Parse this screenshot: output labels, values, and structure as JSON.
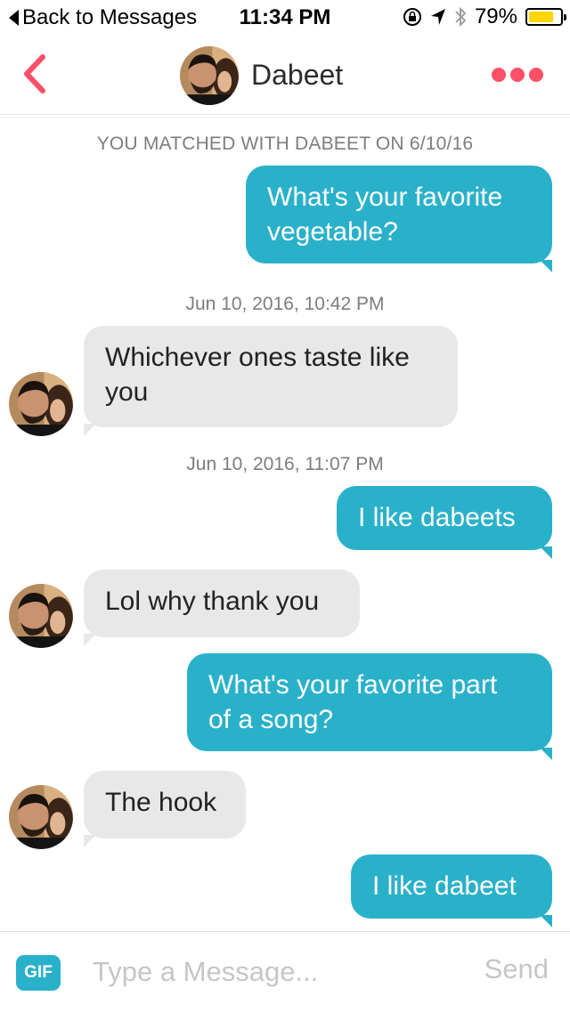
{
  "status_bar": {
    "back_label": "Back to Messages",
    "time": "11:34 PM",
    "battery_percent_label": "79%",
    "battery_level": 0.79,
    "icons": [
      "orientation-lock-icon",
      "location-arrow-icon",
      "bluetooth-icon",
      "battery-icon"
    ]
  },
  "header": {
    "name": "Dabeet",
    "accent_color": "#fd5068",
    "icons": [
      "back-chevron-icon",
      "more-dots-icon"
    ]
  },
  "conversation": {
    "match_banner": "YOU MATCHED WITH DABEET ON 6/10/16",
    "messages": [
      {
        "direction": "out",
        "lines": [
          "What's your favorite",
          "vegetable?"
        ]
      },
      {
        "type": "timestamp",
        "text": "Jun 10, 2016, 10:42 PM"
      },
      {
        "direction": "in",
        "lines": [
          "Whichever ones taste like",
          "you"
        ]
      },
      {
        "type": "timestamp",
        "text": "Jun 10, 2016, 11:07 PM"
      },
      {
        "direction": "out",
        "lines": [
          "I like dabeets"
        ]
      },
      {
        "direction": "in",
        "lines": [
          "Lol why thank you"
        ]
      },
      {
        "direction": "out",
        "lines": [
          "What's your favorite part",
          "of a song?"
        ]
      },
      {
        "direction": "in",
        "lines": [
          "The hook"
        ]
      },
      {
        "direction": "out",
        "lines": [
          "I like dabeet"
        ]
      }
    ],
    "outgoing_color": "#2ab1ca",
    "incoming_color": "#e8e8e8"
  },
  "composer": {
    "gif_label": "GIF",
    "placeholder": "Type a Message...",
    "send_label": "Send"
  }
}
